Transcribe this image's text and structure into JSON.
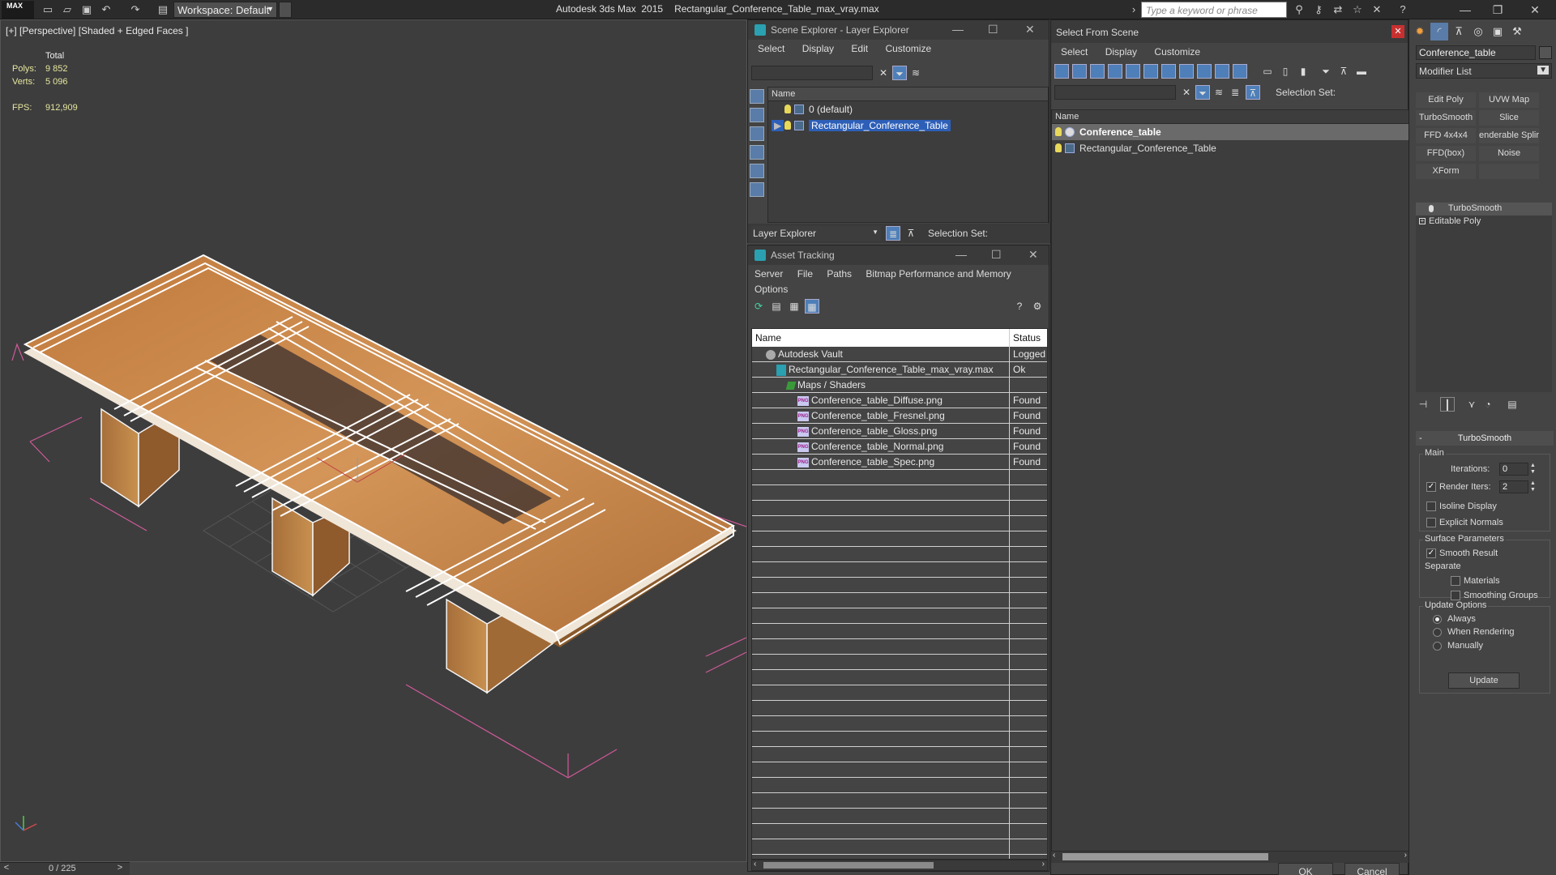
{
  "titlebar": {
    "app_logo": "MAX",
    "workspace": "Workspace: Default",
    "app_name": "Autodesk 3ds Max  2015",
    "file_name": "Rectangular_Conference_Table_max_vray.max",
    "search_placeholder": "Type a keyword or phrase"
  },
  "viewport": {
    "label": "[+] [Perspective] [Shaded + Edged Faces ]",
    "stats": {
      "total_label": "Total",
      "polys_label": "Polys:",
      "polys_value": "9 852",
      "verts_label": "Verts:",
      "verts_value": "5 096",
      "fps_label": "FPS:",
      "fps_value": "912,909"
    }
  },
  "timeslider": {
    "left": "<",
    "value": "0 / 225",
    "right": ">"
  },
  "scene_explorer": {
    "title": "Scene Explorer - Layer Explorer",
    "menu": [
      "Select",
      "Display",
      "Edit",
      "Customize"
    ],
    "column_name": "Name",
    "rows": [
      {
        "label": "0 (default)"
      },
      {
        "label": "Rectangular_Conference_Table"
      }
    ],
    "bottom_dropdown": "Layer Explorer",
    "selection_set_label": "Selection Set:"
  },
  "asset_tracking": {
    "title": "Asset Tracking",
    "menu_row1": [
      "Server",
      "File",
      "Paths",
      "Bitmap Performance and Memory"
    ],
    "menu_row2": [
      "Options"
    ],
    "col_name": "Name",
    "col_status": "Status",
    "rows": [
      {
        "name": "Autodesk Vault",
        "status": "Logged",
        "indent": 1,
        "icon": "vault"
      },
      {
        "name": "Rectangular_Conference_Table_max_vray.max",
        "status": "Ok",
        "indent": 2,
        "icon": "max"
      },
      {
        "name": "Maps / Shaders",
        "status": "",
        "indent": 3,
        "icon": "folder"
      },
      {
        "name": "Conference_table_Diffuse.png",
        "status": "Found",
        "indent": 4,
        "icon": "png"
      },
      {
        "name": "Conference_table_Fresnel.png",
        "status": "Found",
        "indent": 4,
        "icon": "png"
      },
      {
        "name": "Conference_table_Gloss.png",
        "status": "Found",
        "indent": 4,
        "icon": "png"
      },
      {
        "name": "Conference_table_Normal.png",
        "status": "Found",
        "indent": 4,
        "icon": "png"
      },
      {
        "name": "Conference_table_Spec.png",
        "status": "Found",
        "indent": 4,
        "icon": "png"
      }
    ],
    "png_tag": "PNG"
  },
  "select_from_scene": {
    "title": "Select From Scene",
    "menu": [
      "Select",
      "Display",
      "Customize"
    ],
    "selection_set_label": "Selection Set:",
    "column_name": "Name",
    "rows": [
      {
        "label": "Conference_table",
        "selected": true
      },
      {
        "label": "Rectangular_Conference_Table",
        "selected": false
      }
    ],
    "ok_label": "OK",
    "cancel_label": "Cancel"
  },
  "command_panel": {
    "object_name": "Conference_table",
    "modifier_list": "Modifier List",
    "modifier_buttons": [
      "Edit Poly",
      "UVW Map",
      "TurboSmooth",
      "Slice",
      "FFD 4x4x4",
      "enderable Splir",
      "FFD(box)",
      "Noise",
      "XForm",
      ""
    ],
    "stack": [
      "TurboSmooth",
      "Editable Poly"
    ],
    "rollout": {
      "title": "TurboSmooth",
      "main_group": "Main",
      "iterations_label": "Iterations:",
      "iterations_value": "0",
      "render_iters_label": "Render Iters:",
      "render_iters_value": "2",
      "render_iters_checked": true,
      "isoline_label": "Isoline Display",
      "explicit_normals_label": "Explicit Normals",
      "surface_group": "Surface Parameters",
      "smooth_result_label": "Smooth Result",
      "separate_label": "Separate",
      "materials_label": "Materials",
      "smoothing_groups_label": "Smoothing Groups",
      "update_group": "Update Options",
      "always_label": "Always",
      "when_rendering_label": "When Rendering",
      "manually_label": "Manually",
      "update_button": "Update"
    }
  },
  "colors": {
    "wood_light": "#c98a4e",
    "wood_dark": "#9a6430",
    "selection_blue": "#2d5fb8",
    "bbox_pink": "#d05a9a"
  }
}
